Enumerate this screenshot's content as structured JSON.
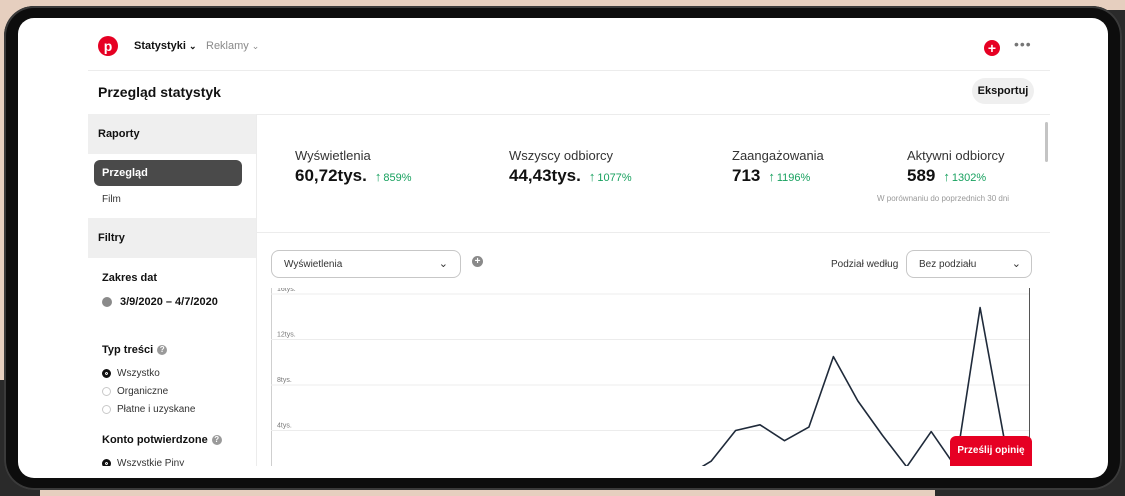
{
  "nav": {
    "logo": "p",
    "items": [
      {
        "label": "Statystyki",
        "chevron": "⌄"
      },
      {
        "label": "Reklamy",
        "chevron": "⌄"
      }
    ],
    "plus": "+",
    "more": "•••"
  },
  "header": {
    "title": "Przegląd statystyk",
    "export_label": "Eksportuj"
  },
  "sidebar": {
    "reports_label": "Raporty",
    "active_item": "Przegląd",
    "film_item": "Film",
    "filters_label": "Filtry",
    "date_range_label": "Zakres dat",
    "date_range_value": "3/9/2020 – 4/7/2020",
    "content_type_label": "Typ treści",
    "content_type_options": [
      {
        "label": "Wszystko",
        "selected": true
      },
      {
        "label": "Organiczne",
        "selected": false
      },
      {
        "label": "Płatne i uzyskane",
        "selected": false
      }
    ],
    "confirmed_account_label": "Konto potwierdzone",
    "confirmed_account_options": [
      {
        "label": "Wszystkie Piny",
        "selected": true
      }
    ],
    "help_glyph": "?"
  },
  "stats": [
    {
      "label": "Wyświetlenia",
      "value": "60,72tys.",
      "change": "859%"
    },
    {
      "label": "Wszyscy odbiorcy",
      "value": "44,43tys.",
      "change": "1077%"
    },
    {
      "label": "Zaangażowania",
      "value": "713",
      "change": "1196%"
    },
    {
      "label": "Aktywni odbiorcy",
      "value": "589",
      "change": "1302%"
    }
  ],
  "stats_up_glyph": "↑",
  "compare_note": "W porównaniu do poprzednich 30 dni",
  "controls": {
    "metric_value": "Wyświetlenia",
    "add_glyph": "+",
    "split_label": "Podział według",
    "split_value": "Bez podziału",
    "chevron": "⌄"
  },
  "feedback_label": "Prześlij opinię",
  "colors": {
    "brand": "#e60023",
    "positive": "#18a15f"
  },
  "chart_data": {
    "type": "line",
    "y_tick_labels": [
      "16tys.",
      "12tys.",
      "8tys.",
      "4tys."
    ],
    "ylim": [
      0,
      16000
    ],
    "grid": true,
    "series": [
      {
        "values": [
          0,
          0,
          0,
          0,
          0,
          0,
          0,
          0,
          0,
          0,
          0,
          0,
          0,
          0,
          0,
          0,
          0,
          0,
          1300,
          4000,
          4500,
          3100,
          4300,
          10500,
          6600,
          3600,
          800,
          3900,
          800,
          14800,
          3100,
          3400
        ]
      }
    ]
  }
}
